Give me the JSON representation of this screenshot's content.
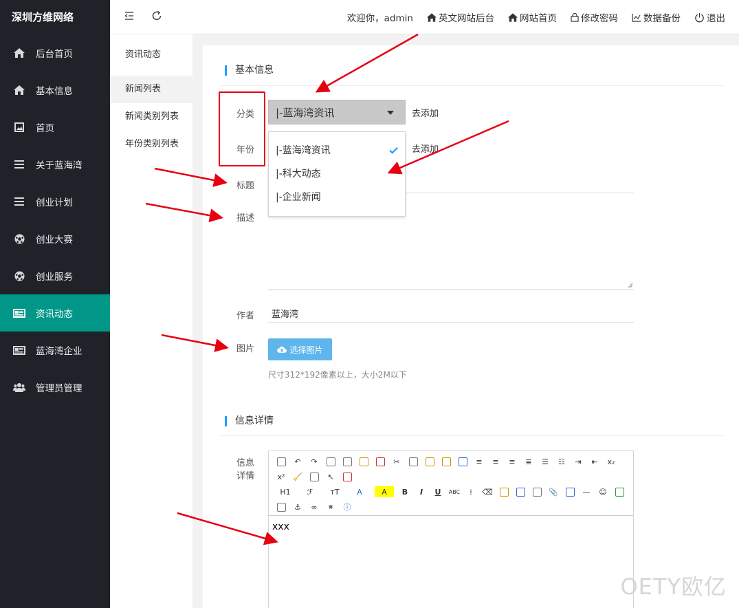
{
  "brand": "深圳方维网络",
  "sidebar": {
    "items": [
      {
        "label": "后台首页",
        "icon": "home-icon"
      },
      {
        "label": "基本信息",
        "icon": "home-icon"
      },
      {
        "label": "首页",
        "icon": "image-icon"
      },
      {
        "label": "关于蓝海湾",
        "icon": "list-icon"
      },
      {
        "label": "创业计划",
        "icon": "list-icon"
      },
      {
        "label": "创业大赛",
        "icon": "soccer-ball-icon"
      },
      {
        "label": "创业服务",
        "icon": "soccer-ball-icon"
      },
      {
        "label": "资讯动态",
        "icon": "newspaper-icon",
        "active": true
      },
      {
        "label": "蓝海湾企业",
        "icon": "newspaper-icon"
      },
      {
        "label": "管理员管理",
        "icon": "users-icon"
      }
    ]
  },
  "topbar": {
    "welcome": "欢迎你，admin",
    "links": [
      {
        "label": "英文网站后台",
        "icon": "home-icon"
      },
      {
        "label": "网站首页",
        "icon": "home-icon"
      },
      {
        "label": "修改密码",
        "icon": "lock-icon"
      },
      {
        "label": "数据备份",
        "icon": "chart-icon"
      },
      {
        "label": "退出",
        "icon": "power-icon"
      }
    ]
  },
  "subnav": {
    "title": "资讯动态",
    "items": [
      "新闻列表",
      "新闻类别列表",
      "年份类别列表"
    ]
  },
  "form": {
    "section1": "基本信息",
    "category_label": "分类",
    "category_value": "|-蓝海湾资讯",
    "add_link": "去添加",
    "year_label": "年份",
    "year_add_link": "去添加",
    "title_label": "标题",
    "desc_label": "描述",
    "author_label": "作者",
    "author_value": "蓝海湾",
    "image_label": "图片",
    "upload_button": "选择图片",
    "upload_hint": "尺寸312*192像素以上，大小2M以下",
    "section2": "信息详情",
    "detail_label_1": "信息",
    "detail_label_2": "详情",
    "editor_content": "xxx"
  },
  "dropdown": {
    "options": [
      "|-蓝海湾资讯",
      "|-科大动态",
      "|-企业新闻"
    ],
    "selected_index": 0
  },
  "editor_toolbar": {
    "heading": "H1",
    "font": "ℱ",
    "size": "тT",
    "font_color": "A",
    "highlight": "A",
    "bold": "B",
    "italic": "I",
    "underline": "U",
    "strike": "ABC",
    "sub": "x₂",
    "sup": "x²"
  },
  "colors": {
    "sidebar_bg": "#20222a",
    "active": "#009688",
    "accent": "#1e9fff",
    "upload_btn": "#5fb6ec",
    "annotation": "#e60012"
  },
  "watermark": "OETY欧亿"
}
